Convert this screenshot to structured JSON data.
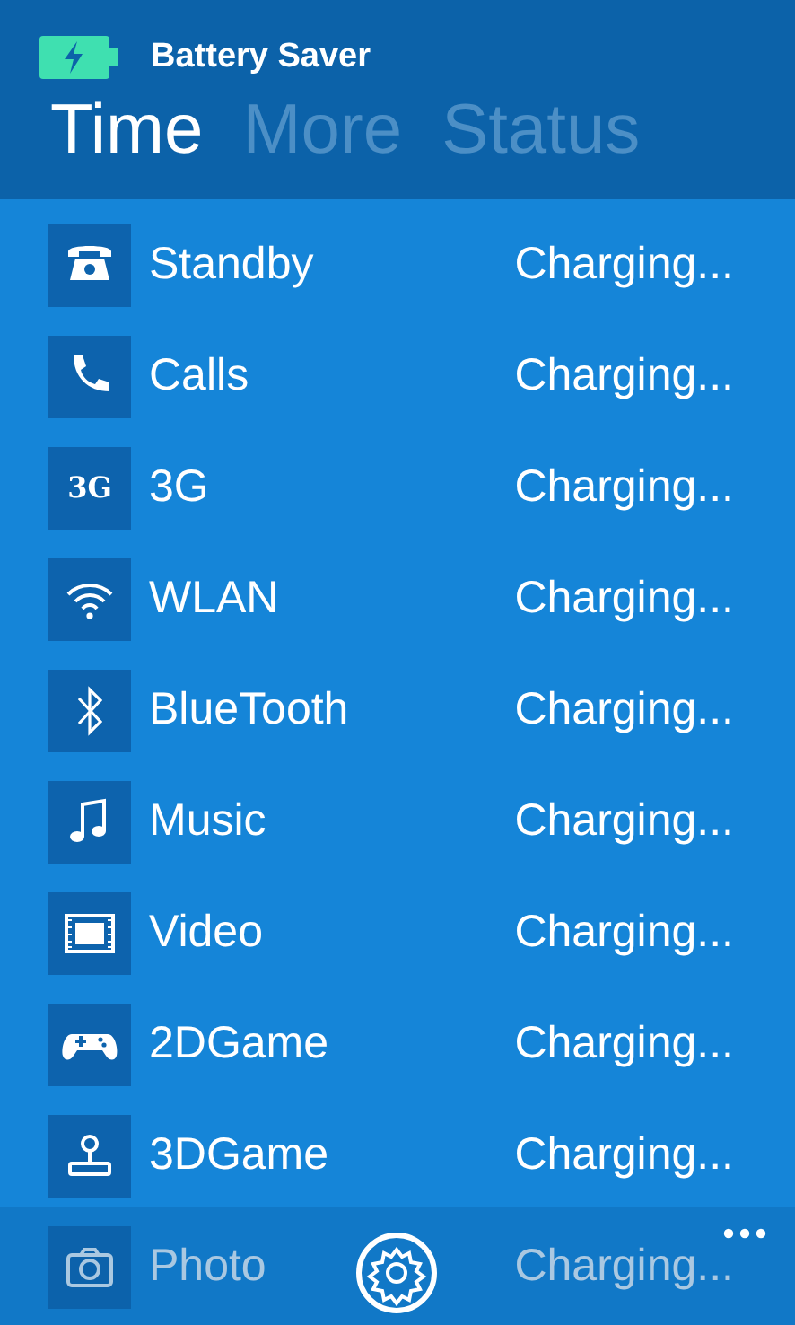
{
  "app": {
    "title": "Battery Saver"
  },
  "tabs": [
    {
      "label": "Time",
      "selected": true
    },
    {
      "label": "More",
      "selected": false
    },
    {
      "label": "Status",
      "selected": false
    }
  ],
  "rows": [
    {
      "kind": "icon",
      "label": "Standby",
      "status": "Charging..."
    },
    {
      "kind": "icon",
      "label": "Calls",
      "status": "Charging..."
    },
    {
      "kind": "glyph",
      "icon_text": "3G",
      "label": "3G",
      "status": "Charging..."
    },
    {
      "kind": "icon",
      "label": "WLAN",
      "status": "Charging..."
    },
    {
      "kind": "icon",
      "label": "BlueTooth",
      "status": "Charging..."
    },
    {
      "kind": "icon",
      "label": "Music",
      "status": "Charging..."
    },
    {
      "kind": "icon",
      "label": "Video",
      "status": "Charging..."
    },
    {
      "kind": "icon",
      "label": "2DGame",
      "status": "Charging..."
    },
    {
      "kind": "icon",
      "label": "3DGame",
      "status": "Charging..."
    },
    {
      "kind": "icon",
      "label": "Photo",
      "status": "Charging..."
    }
  ]
}
